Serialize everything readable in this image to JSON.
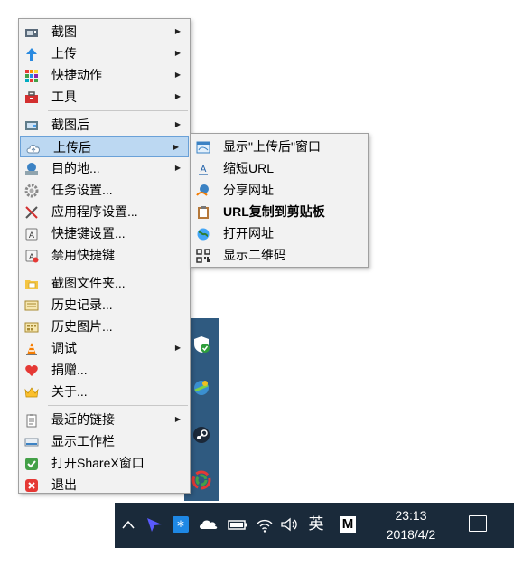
{
  "main_menu": {
    "items": [
      {
        "label": "截图",
        "icon": "capture-icon",
        "submenu": true
      },
      {
        "label": "上传",
        "icon": "upload-arrow-icon",
        "submenu": true
      },
      {
        "label": "快捷动作",
        "icon": "grid-actions-icon",
        "submenu": true
      },
      {
        "label": "工具",
        "icon": "toolbox-icon",
        "submenu": true
      },
      {
        "label": "截图后",
        "icon": "after-capture-icon",
        "submenu": true
      },
      {
        "label": "上传后",
        "icon": "cloud-upload-icon",
        "submenu": true,
        "highlighted": true
      },
      {
        "label": "目的地...",
        "icon": "destination-icon",
        "submenu": true
      },
      {
        "label": "任务设置...",
        "icon": "gear-icon",
        "submenu": false
      },
      {
        "label": "应用程序设置...",
        "icon": "tools-icon",
        "submenu": false
      },
      {
        "label": "快捷键设置...",
        "icon": "keyboard-icon",
        "submenu": false
      },
      {
        "label": "禁用快捷键",
        "icon": "keyboard-disabled-icon",
        "submenu": false
      },
      {
        "label": "截图文件夹...",
        "icon": "folder-icon",
        "submenu": false
      },
      {
        "label": "历史记录...",
        "icon": "history-icon",
        "submenu": false
      },
      {
        "label": "历史图片...",
        "icon": "image-history-icon",
        "submenu": false
      },
      {
        "label": "调试",
        "icon": "traffic-cone-icon",
        "submenu": true
      },
      {
        "label": "捐赠...",
        "icon": "heart-icon",
        "submenu": false
      },
      {
        "label": "关于...",
        "icon": "crown-icon",
        "submenu": false
      },
      {
        "label": "最近的链接",
        "icon": "clipboard-list-icon",
        "submenu": true
      },
      {
        "label": "显示工作栏",
        "icon": "taskbar-icon",
        "submenu": false
      },
      {
        "label": "打开ShareX窗口",
        "icon": "check-icon",
        "submenu": false
      },
      {
        "label": "退出",
        "icon": "close-icon",
        "submenu": false
      }
    ]
  },
  "sub_menu": {
    "items": [
      {
        "label": "显示\"上传后\"窗口",
        "icon": "window-icon"
      },
      {
        "label": "缩短URL",
        "icon": "shorten-url-icon"
      },
      {
        "label": "分享网址",
        "icon": "share-url-icon"
      },
      {
        "label": "URL复制到剪贴板",
        "icon": "clipboard-icon",
        "bold": true
      },
      {
        "label": "打开网址",
        "icon": "globe-icon"
      },
      {
        "label": "显示二维码",
        "icon": "qr-code-icon"
      }
    ]
  },
  "taskbar": {
    "ime_label": "英",
    "clock_time": "23:13",
    "clock_date": "2018/4/2",
    "input_mode": "M"
  },
  "colors": {
    "highlight_bg": "#bcd8f2",
    "highlight_border": "#6aa1d8",
    "taskbar_bg": "#1a2a3a",
    "tray_panel_bg": "#2f5a80"
  }
}
